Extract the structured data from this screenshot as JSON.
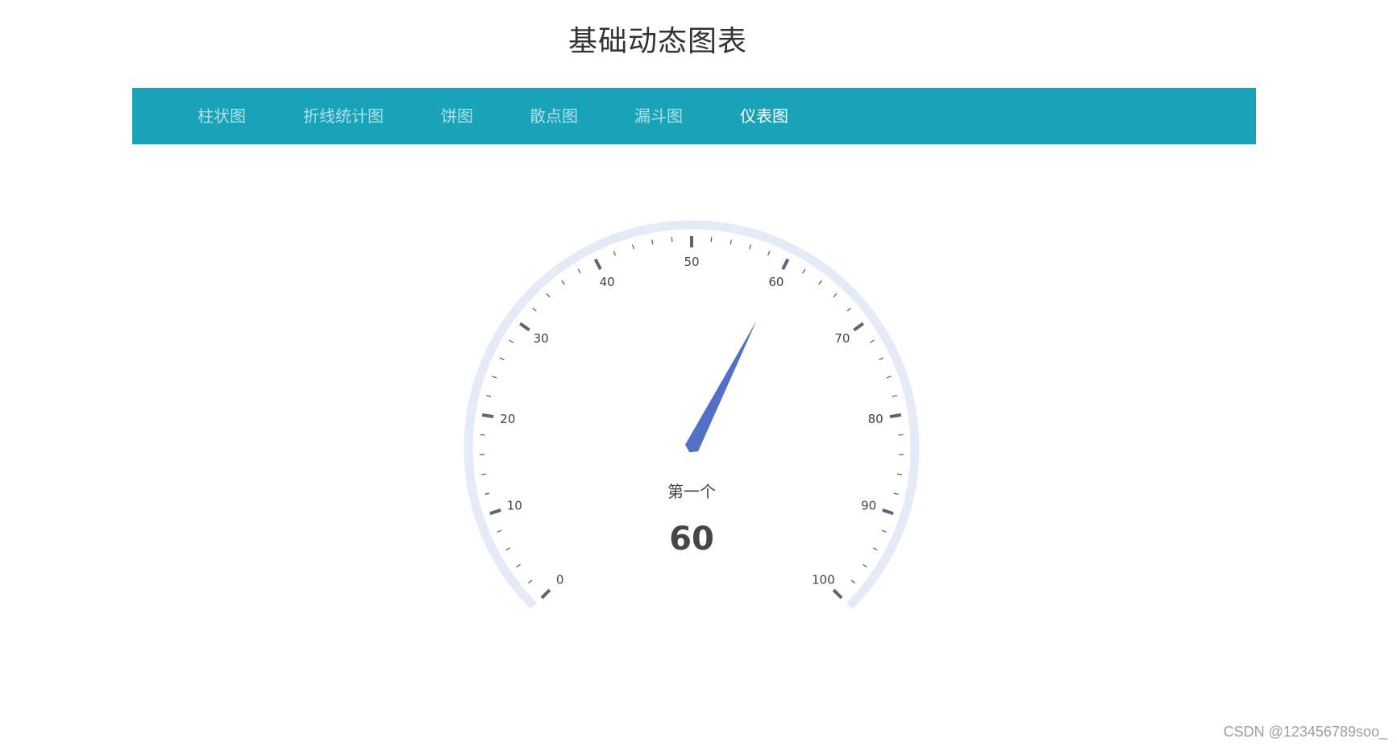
{
  "page": {
    "title": "基础动态图表"
  },
  "nav": {
    "items": [
      {
        "label": "柱状图",
        "active": false
      },
      {
        "label": "折线统计图",
        "active": false
      },
      {
        "label": "饼图",
        "active": false
      },
      {
        "label": "散点图",
        "active": false
      },
      {
        "label": "漏斗图",
        "active": false
      },
      {
        "label": "仪表图",
        "active": true
      }
    ]
  },
  "gauge": {
    "series_name": "第一个",
    "value": 60,
    "min": 0,
    "max": 100,
    "tick_labels": [
      "0",
      "10",
      "20",
      "30",
      "40",
      "50",
      "60",
      "70",
      "80",
      "90",
      "100"
    ],
    "colors": {
      "track": "#e4eaf6",
      "ticks": "#5f6578",
      "pointer": "#5470c6",
      "label": "#444444",
      "value": "#464646"
    }
  },
  "chart_data": {
    "type": "gauge",
    "series": [
      {
        "name": "第一个",
        "values": [
          60
        ]
      }
    ],
    "range": [
      0,
      100
    ]
  },
  "watermark": {
    "text": "CSDN @123456789soo_"
  },
  "colors": {
    "nav_background": "#19a3b9"
  }
}
